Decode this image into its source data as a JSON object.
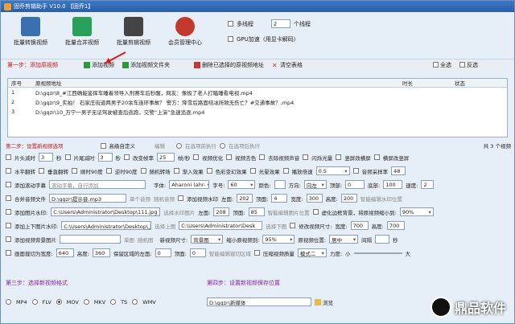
{
  "title": "固乔剪辑助手 V10.0 【固乔1】",
  "toolbar": [
    {
      "label": "批量转换视频",
      "icon": "film-convert-icon",
      "color": "#3a6fb0"
    },
    {
      "label": "批量合并视频",
      "icon": "merge-grid-icon",
      "color": "#2aa05a"
    },
    {
      "label": "批量剪辑视频",
      "icon": "clapper-icon",
      "color": "#444"
    },
    {
      "label": "会员管理中心",
      "icon": "user-icon",
      "color": "#c0392b"
    }
  ],
  "options": {
    "multithread": "多线程",
    "threads": "2",
    "threads_unit": "个线程",
    "gpu": "GPU加速（用显卡解码）"
  },
  "step1": {
    "title": "第一步：添加原视频",
    "add": "添加视频",
    "add_folder": "添加视频文件夹",
    "delete": "删除已选择的原视频地址",
    "clear": "清空表格",
    "select_all": "全选",
    "invert": "反选"
  },
  "table": {
    "headers": [
      "序号",
      "原视频地址",
      "时长",
      "状态"
    ],
    "rows": [
      {
        "n": "1",
        "path": "D:\\gqzr\\8_#江西确能鉴挥车睡着领导入刑赛车后秒醒，网友：像极了老人打瞌睡看电视.mp4"
      },
      {
        "n": "2",
        "path": "D:\\gqzr\\9_实拍！ 石家庄街道两男子20余车连环事故？ 警方：降雪后路面结冰所致无伤亡？#交通事故？.mp4"
      },
      {
        "n": "3",
        "path": "D:\\gqzr\\10_万宁一男子无证驾驶被查后逃跑，交警“上演”急速追逐.mp4"
      }
    ],
    "count": "共 3 个视频"
  },
  "step2": {
    "title": "第二步：设置新视频选项",
    "advanced": "高级自定义",
    "edit": "编辑",
    "before": "在选项前执行",
    "after": "在选项后执行"
  },
  "f1": {
    "cut_head": "片头减时",
    "v1": "3",
    "s1": "秒",
    "cut_tail": "片尾减时",
    "v2": "3",
    "s2": "秒",
    "change_fps": "改变帧率",
    "fps": "25",
    "fps_unit": "帧/秒",
    "opt": "视频优化",
    "color": "视频去色",
    "rm_audio": "去除视频声音",
    "flash": "闪烁光量",
    "portrait": "竖屏改横屏",
    "landscape": "横屏改竖屏"
  },
  "f2": {
    "hflip": "水平翻转",
    "vflip": "垂直翻转",
    "rot90": "顺时90度",
    "rrot90": "逆时90度",
    "random": "随机转场",
    "fade": "渐入效果",
    "hue": "色彩变幻效果",
    "light": "光晕效果",
    "speed": "播放倍速",
    "speed_v": "0.5",
    "sample": "音频采样率",
    "sample_v": "48"
  },
  "f3": {
    "sub": "添加滚动字幕",
    "sub_v": "滚动字幕，自行添加",
    "font": "字体:",
    "font_v": "Aharoni (ahr-",
    "size": "字号:",
    "size_v": "60",
    "color": "颜色:",
    "dir": "方向:",
    "dir_v": "向左",
    "top": "顶部:",
    "top_v": "0",
    "bottom": "底部:",
    "bottom_v": "100",
    "speed": "速度:",
    "speed_v": "2"
  },
  "f4": {
    "audio": "合并音频文件",
    "audio_v": "D:\\gqzr\\提示音.mp3",
    "single": "单个音频",
    "random_audio": "随机音频",
    "wm": "添加视频水印",
    "left": "左面:",
    "left_v": "202",
    "top": "顶面:",
    "top_v": "4",
    "width": "宽度:",
    "width_v": "300",
    "height": "高度:",
    "height_v": "200",
    "smart": "智能编辑水印位置"
  },
  "f5": {
    "pic": "添加图片水印:",
    "pic_v": "C:\\Users\\Administrator\\Desktop\\111.jpg",
    "choose": "选择水印图片",
    "left": "左面:",
    "left_v": "208",
    "top": "顶面:",
    "top_v": "85",
    "smart": "智能编辑图片位置",
    "blur": "虚化边框背景，将原视频缩小到:",
    "blur_v": "90%"
  },
  "f6": {
    "tb": "添加上下图片水印:",
    "tb_v": "C:\\Users\\Administrator\\Desktop\\上面",
    "up": "选择上图",
    "tb2": "C:\\Users\\Administrator\\Desk",
    "down": "选择下图",
    "resize": "修改视频尺寸:",
    "w": "宽度:",
    "w_v": "700",
    "h": "高度:",
    "h_v": "700"
  },
  "f7": {
    "bg": "添加视频背景图片",
    "single": "单图",
    "random": "随机图",
    "size": "新视频尺寸:",
    "size_v": "背景图",
    "scale": "缩小原视频到:",
    "scale_v": "95%",
    "pos": "原视频位置:",
    "pos_v": "居中",
    "gap": "间隔",
    "secs": "秒"
  },
  "f8": {
    "crop": "画面裁切为宽度:",
    "crop_v": "640",
    "h": "高度:",
    "h_v": "360",
    "keep": "保留区域的左面:",
    "left_v": "0",
    "top": "顶面:",
    "top_v": "0",
    "smart": "智能编辑裁切区域",
    "compress": "压缩视频质量",
    "mode": "模式二",
    "power": "力度:",
    "small": "小",
    "big": "大"
  },
  "step3": {
    "title": "第三步：选择新视频格式",
    "formats": [
      "MP4",
      "FLV",
      "MOV",
      "MKV",
      "TS",
      "WMV"
    ],
    "selected": "MOV"
  },
  "step4": {
    "title": "第四步：设置新视频保存位置",
    "path": "D:\\gqzr\\新媒体",
    "browse": "浏览"
  },
  "watermark": "鼎品软件"
}
